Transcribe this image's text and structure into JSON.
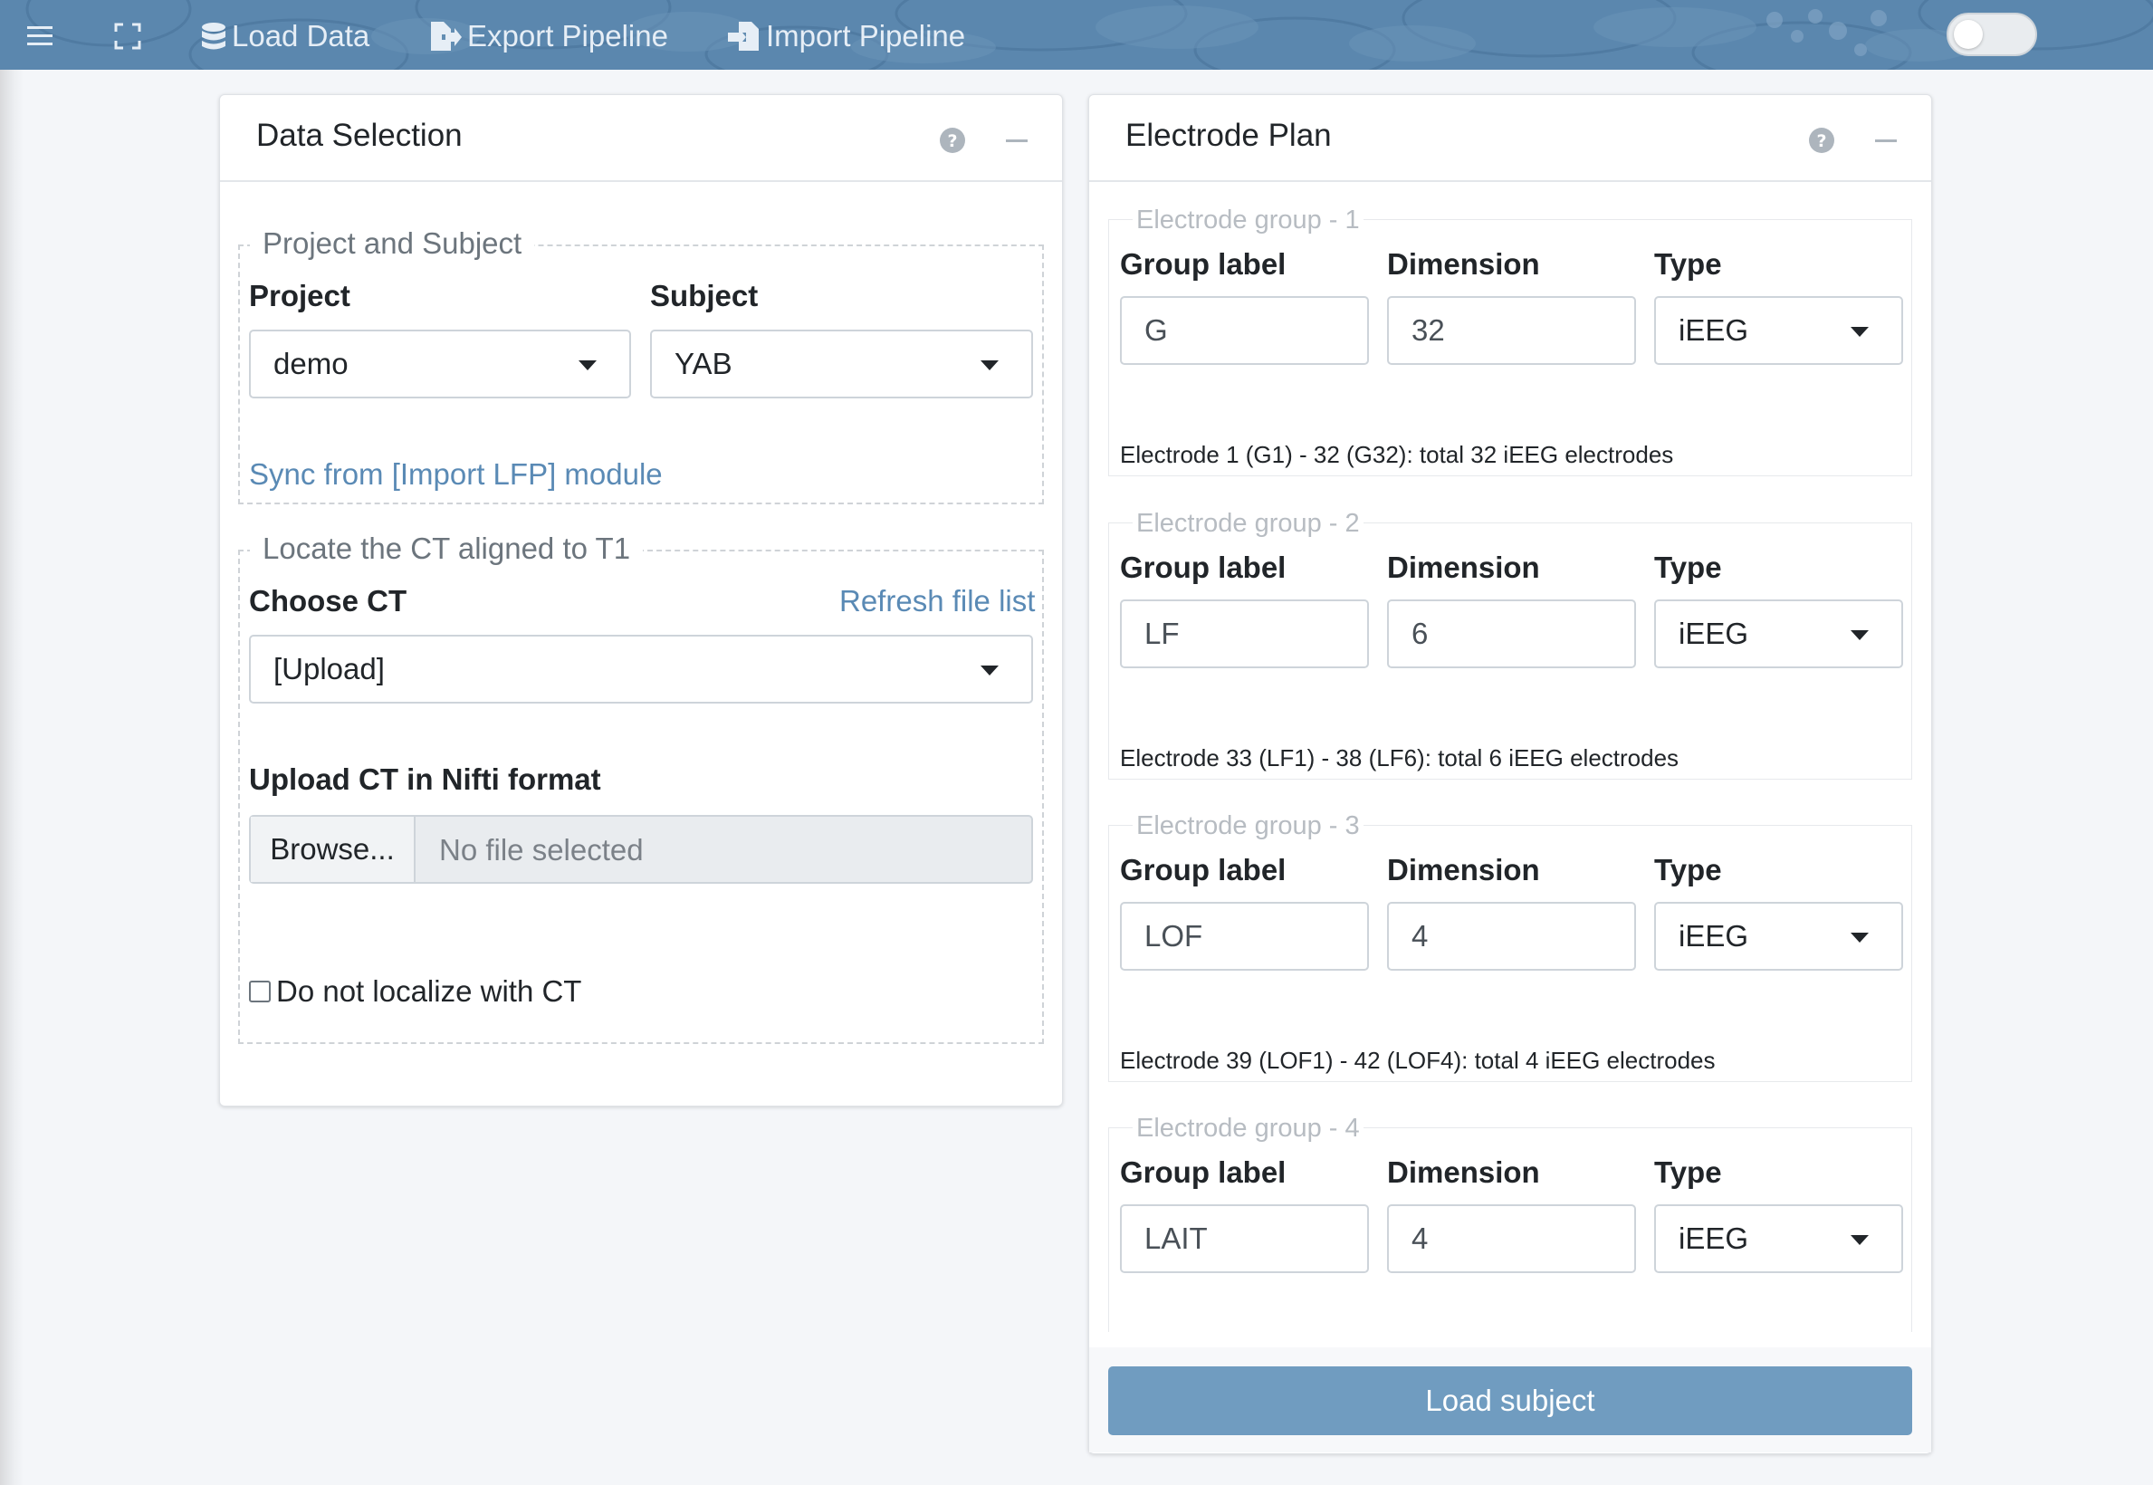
{
  "topbar": {
    "items": [
      {
        "label": "",
        "icon": "hamburger-icon"
      },
      {
        "label": "",
        "icon": "expand-icon"
      },
      {
        "label": "Load Data",
        "icon": "database-icon"
      },
      {
        "label": "Export Pipeline",
        "icon": "file-export-icon"
      },
      {
        "label": "Import Pipeline",
        "icon": "file-import-icon"
      }
    ],
    "toggle_on": false,
    "colors": {
      "bar": "#5b87ae",
      "text": "#e6eef6"
    }
  },
  "data_selection": {
    "title": "Data Selection",
    "project_subject": {
      "legend": "Project and Subject",
      "project_label": "Project",
      "project_value": "demo",
      "subject_label": "Subject",
      "subject_value": "YAB",
      "sync_link": "Sync from [Import LFP] module"
    },
    "ct": {
      "legend": "Locate the CT aligned to T1",
      "choose_label": "Choose CT",
      "refresh_link": "Refresh file list",
      "choose_value": "[Upload]",
      "upload_label": "Upload CT in Nifti format",
      "browse_label": "Browse...",
      "file_placeholder": "No file selected",
      "checkbox_label": "Do not localize with CT",
      "checkbox_checked": false
    }
  },
  "electrode_plan": {
    "title": "Electrode Plan",
    "column_labels": {
      "label": "Group label",
      "dimension": "Dimension",
      "type": "Type"
    },
    "groups": [
      {
        "legend": "Electrode group - 1",
        "label": "G",
        "dimension": "32",
        "type": "iEEG",
        "summary": "Electrode 1 (G1) - 32 (G32): total 32 iEEG electrodes"
      },
      {
        "legend": "Electrode group - 2",
        "label": "LF",
        "dimension": "6",
        "type": "iEEG",
        "summary": "Electrode 33 (LF1) - 38 (LF6): total 6 iEEG electrodes"
      },
      {
        "legend": "Electrode group - 3",
        "label": "LOF",
        "dimension": "4",
        "type": "iEEG",
        "summary": "Electrode 39 (LOF1) - 42 (LOF4): total 4 iEEG electrodes"
      },
      {
        "legend": "Electrode group - 4",
        "label": "LAIT",
        "dimension": "4",
        "type": "iEEG",
        "summary": ""
      }
    ],
    "load_button": "Load subject",
    "accent": "#709cc0"
  }
}
